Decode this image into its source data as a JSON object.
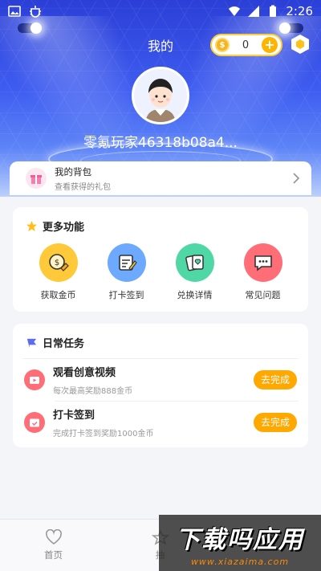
{
  "status_bar": {
    "time": "2:26"
  },
  "header": {
    "title": "我的",
    "coin_count": "0",
    "username": "零氪玩家46318b08a4..."
  },
  "bag": {
    "title": "我的背包",
    "subtitle": "查看获得的礼包"
  },
  "more_features": {
    "title": "更多功能",
    "items": [
      {
        "label": "获取金币",
        "icon": "coin-hand-icon",
        "color": "#ffc93a"
      },
      {
        "label": "打卡签到",
        "icon": "checkin-icon",
        "color": "#6da9ff"
      },
      {
        "label": "兑换详情",
        "icon": "exchange-icon",
        "color": "#4fd8a6"
      },
      {
        "label": "常见问题",
        "icon": "faq-icon",
        "color": "#ff6d77"
      }
    ]
  },
  "daily_tasks": {
    "title": "日常任务",
    "items": [
      {
        "title": "观看创意视频",
        "desc": "每次最高奖励888金币",
        "button": "去完成",
        "icon": "video-icon"
      },
      {
        "title": "打卡签到",
        "desc": "完成打卡签到奖励1000金币",
        "button": "去完成",
        "icon": "calendar-icon"
      }
    ]
  },
  "tabbar": {
    "items": [
      {
        "label": "首页",
        "icon": "heart-icon"
      },
      {
        "label": "抽",
        "icon": "star-icon"
      }
    ]
  },
  "watermark": {
    "main": "下载吗应用",
    "url": "www.xiazaima.com"
  },
  "colors": {
    "accent": "#ffa800",
    "hero": "#3e5cf0",
    "task_icon": "#ff6d77"
  }
}
